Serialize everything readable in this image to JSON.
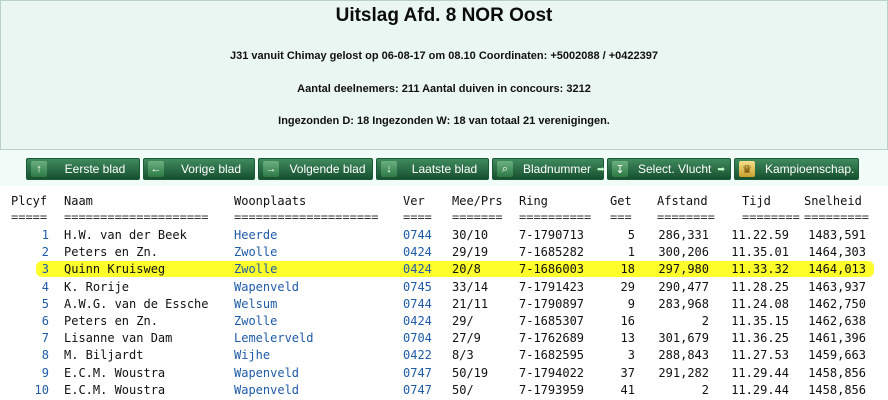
{
  "header": {
    "title": "Uitslag Afd. 8 NOR Oost",
    "line1": "J31 vanuit Chimay gelost op 06-08-17 om 08.10 Coordinaten: +5002088 / +0422397",
    "line2": "Aantal deelnemers: 211 Aantal duiven in concours: 3212",
    "line3": "Ingezonden D: 18 Ingezonden W: 18 van totaal 21 verenigingen."
  },
  "toolbar": [
    {
      "key": "eerste",
      "label": "Eerste blad",
      "icon": "arrow-up-icon"
    },
    {
      "key": "vorige",
      "label": "Vorige blad",
      "icon": "arrow-left-icon"
    },
    {
      "key": "volgende",
      "label": "Volgende blad",
      "icon": "arrow-right-icon"
    },
    {
      "key": "laatste",
      "label": "Laatste blad",
      "icon": "arrow-down-icon"
    },
    {
      "key": "bladnummer",
      "label": "Bladnummer",
      "icon": "search-icon"
    },
    {
      "key": "select",
      "label": "Select. Vlucht",
      "icon": "download-icon"
    },
    {
      "key": "kampioen",
      "label": "Kampioenschap.",
      "icon": "crown-icon"
    }
  ],
  "columns": [
    "Plcyf",
    "Naam",
    "Woonplaats",
    "Ver",
    "Mee/Prs",
    "Ring",
    "Get",
    "Afstand",
    "Tijd",
    "Snelheid"
  ],
  "separators": [
    "=====",
    "====================",
    "====================",
    "====",
    "=======",
    "==========",
    "===",
    "========",
    "========",
    "========="
  ],
  "rows": [
    {
      "plc": "1",
      "naam": "H.W. van der Beek",
      "woon": "Heerde",
      "ver": "0744",
      "mee": "30/10",
      "ring": "7-1790713",
      "get": "5",
      "afst": "286,331",
      "tijd": "11.22.59",
      "snel": "1483,591"
    },
    {
      "plc": "2",
      "naam": "Peters en Zn.",
      "woon": "Zwolle",
      "ver": "0424",
      "mee": "29/19",
      "ring": "7-1685282",
      "get": "1",
      "afst": "300,206",
      "tijd": "11.35.01",
      "snel": "1464,303"
    },
    {
      "plc": "3",
      "naam": "Quinn Kruisweg",
      "woon": "Zwolle",
      "ver": "0424",
      "mee": "20/8",
      "ring": "7-1686003",
      "get": "18",
      "afst": "297,980",
      "tijd": "11.33.32",
      "snel": "1464,013",
      "highlight": true
    },
    {
      "plc": "4",
      "naam": "K. Rorije",
      "woon": "Wapenveld",
      "ver": "0745",
      "mee": "33/14",
      "ring": "7-1791423",
      "get": "29",
      "afst": "290,477",
      "tijd": "11.28.25",
      "snel": "1463,937"
    },
    {
      "plc": "5",
      "naam": "A.W.G. van de Essche",
      "woon": "Welsum",
      "ver": "0744",
      "mee": "21/11",
      "ring": "7-1790897",
      "get": "9",
      "afst": "283,968",
      "tijd": "11.24.08",
      "snel": "1462,750"
    },
    {
      "plc": "6",
      "naam": "Peters en Zn.",
      "woon": "Zwolle",
      "ver": "0424",
      "mee": "29/",
      "ring": "7-1685307",
      "get": "16",
      "afst": "2",
      "tijd": "11.35.15",
      "snel": "1462,638"
    },
    {
      "plc": "7",
      "naam": "Lisanne van Dam",
      "woon": "Lemelerveld",
      "ver": "0704",
      "mee": "27/9",
      "ring": "7-1762689",
      "get": "13",
      "afst": "301,679",
      "tijd": "11.36.25",
      "snel": "1461,396"
    },
    {
      "plc": "8",
      "naam": "M. Biljardt",
      "woon": "Wijhe",
      "ver": "0422",
      "mee": "8/3",
      "ring": "7-1682595",
      "get": "3",
      "afst": "288,843",
      "tijd": "11.27.53",
      "snel": "1459,663"
    },
    {
      "plc": "9",
      "naam": "E.C.M. Woustra",
      "woon": "Wapenveld",
      "ver": "0747",
      "mee": "50/19",
      "ring": "7-1794022",
      "get": "37",
      "afst": "291,282",
      "tijd": "11.29.44",
      "snel": "1458,856"
    },
    {
      "plc": "10",
      "naam": "E.C.M. Woustra",
      "woon": "Wapenveld",
      "ver": "0747",
      "mee": "50/",
      "ring": "7-1793959",
      "get": "41",
      "afst": "2",
      "tijd": "11.29.44",
      "snel": "1458,856"
    }
  ]
}
